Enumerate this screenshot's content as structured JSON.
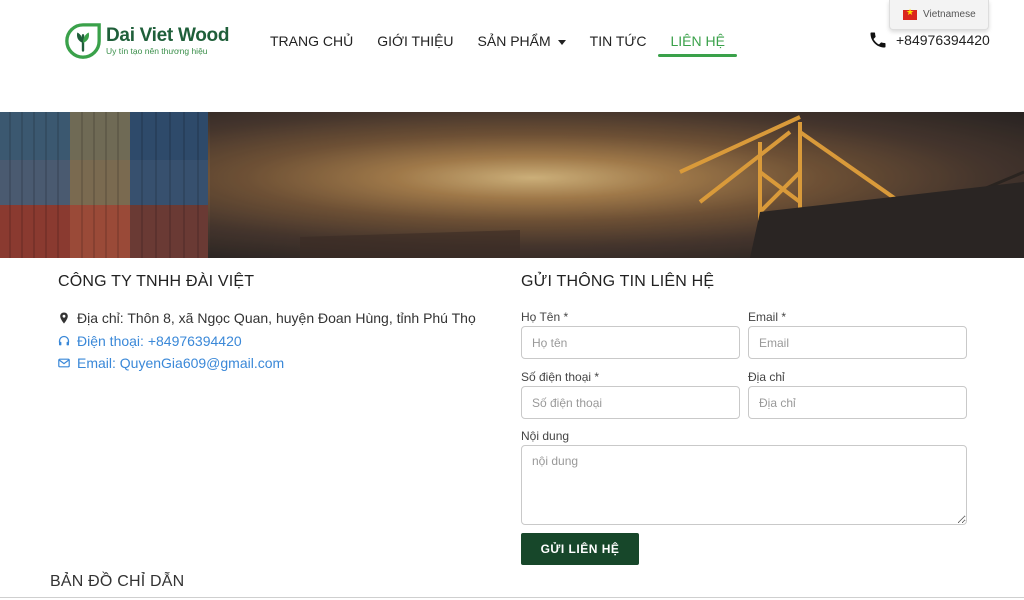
{
  "brand": {
    "name_part1": "Dai Viet",
    "name_part2": "Wood",
    "tagline": "Uy tín tạo nên thương hiệu",
    "colors": {
      "primary": "#1f5f3a",
      "accent": "#3aa14a",
      "button": "#17472a",
      "link": "#3a88d8"
    }
  },
  "nav": {
    "items": [
      {
        "label": "TRANG CHỦ",
        "active": false
      },
      {
        "label": "GIỚI THIỆU",
        "active": false
      },
      {
        "label": "SẢN PHẨM",
        "active": false,
        "has_dropdown": true
      },
      {
        "label": "TIN TỨC",
        "active": false
      },
      {
        "label": "LIÊN HỆ",
        "active": true
      }
    ]
  },
  "header_phone": {
    "icon": "phone-icon",
    "number": "+84976394420"
  },
  "language": {
    "label": "Vietnamese",
    "icon": "vietnam-flag-icon"
  },
  "company": {
    "name": "CÔNG TY TNHH ĐÀI VIỆT",
    "address": "Địa chỉ: Thôn 8, xã Ngọc Quan, huyện Đoan Hùng, tỉnh Phú Thọ",
    "phone": "Điện thoại: +84976394420",
    "email": "Email: QuyenGia609@gmail.com",
    "icons": [
      "map-marker-icon",
      "headphones-icon",
      "envelope-icon"
    ]
  },
  "form": {
    "title": "GỬI THÔNG TIN LIÊN HỆ",
    "fields": {
      "name": {
        "label": "Họ Tên *",
        "placeholder": "Họ tên",
        "value": ""
      },
      "email": {
        "label": "Email *",
        "placeholder": "Email",
        "value": ""
      },
      "phone": {
        "label": "Số điện thoại *",
        "placeholder": "Số điện thoại",
        "value": ""
      },
      "address": {
        "label": "Địa chỉ",
        "placeholder": "Địa chỉ",
        "value": ""
      },
      "message": {
        "label": "Nội dung",
        "placeholder": "nội dung",
        "value": ""
      }
    },
    "submit_label": "GỬI LIÊN HỆ"
  },
  "map_section": {
    "title": "BẢN ĐỒ CHỈ DẪN"
  }
}
